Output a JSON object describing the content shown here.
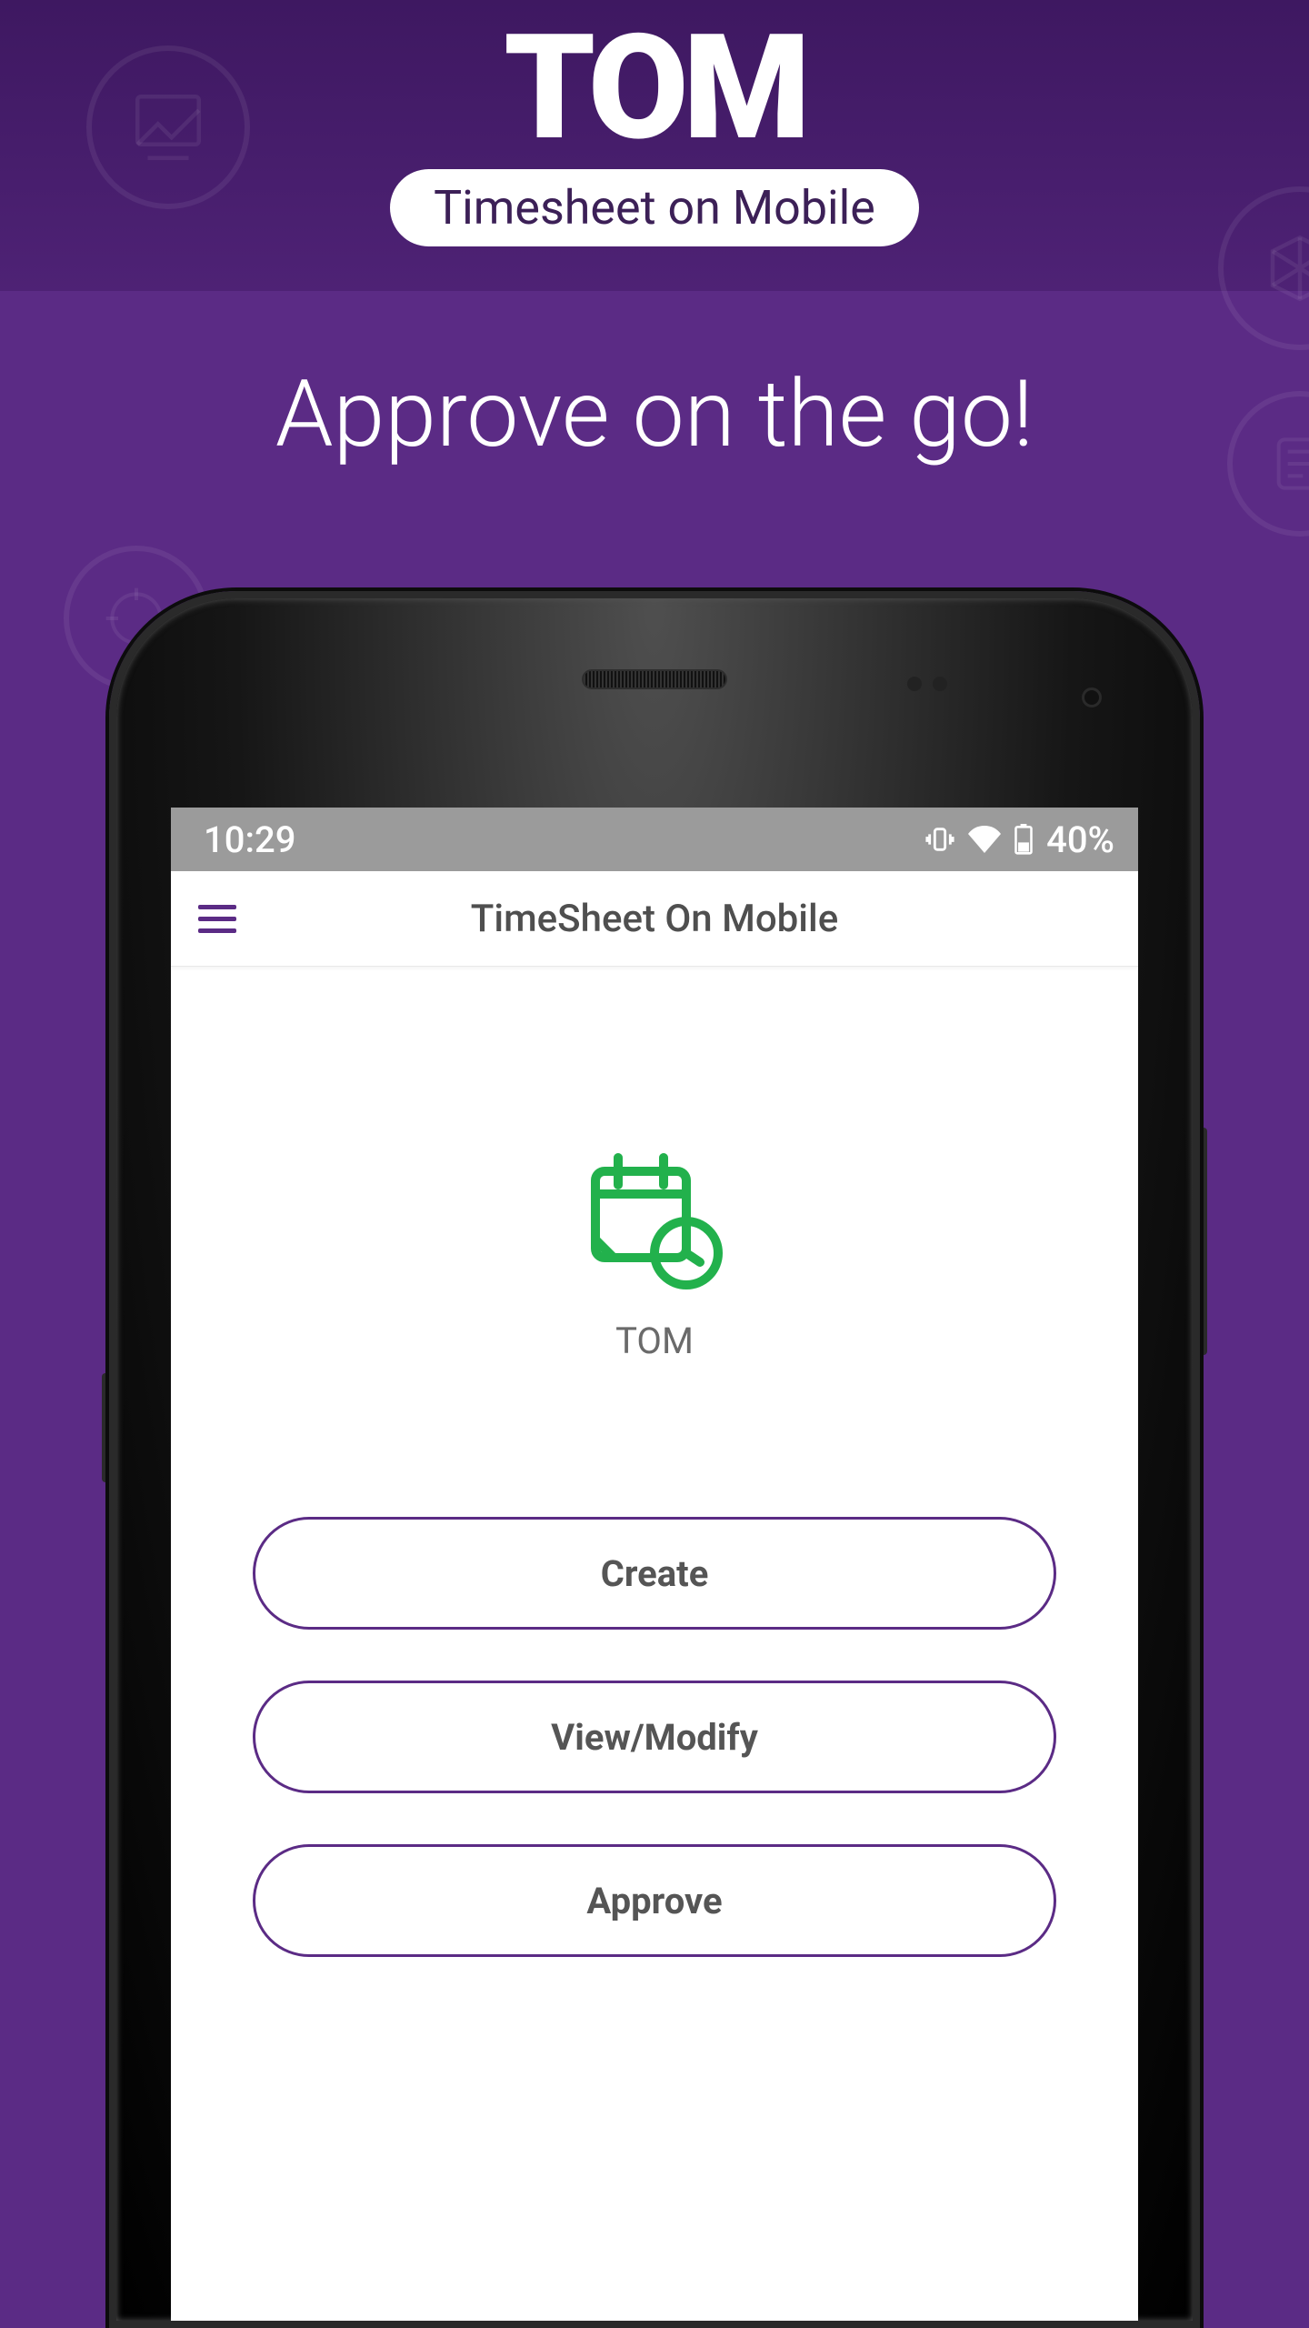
{
  "banner": {
    "logo_text": "TOM",
    "logo_subtitle": "Timesheet on Mobile"
  },
  "tagline": "Approve on the go!",
  "status_bar": {
    "time": "10:29",
    "battery_text": "40%"
  },
  "app": {
    "header_title": "TimeSheet On Mobile",
    "icon_label": "TOM",
    "actions": {
      "create": "Create",
      "view_modify": "View/Modify",
      "approve": "Approve"
    }
  }
}
